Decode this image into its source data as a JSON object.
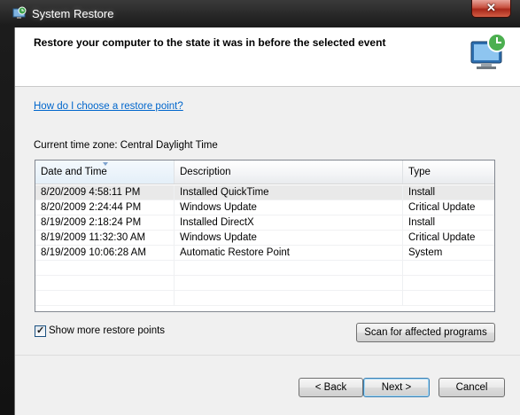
{
  "window": {
    "title": "System Restore",
    "close_glyph": "✕",
    "app_icon": "system-restore-icon"
  },
  "header": {
    "instruction": "Restore your computer to the state it was in before the selected event",
    "icon": "system-restore-monitor-icon"
  },
  "help_link": "How do I choose a restore point?",
  "timezone": "Current time zone: Central Daylight Time",
  "table": {
    "columns": [
      "Date and Time",
      "Description",
      "Type"
    ],
    "sorted_column": "Date and Time",
    "rows": [
      [
        "8/20/2009 4:58:11 PM",
        "Installed QuickTime",
        "Install"
      ],
      [
        "8/20/2009 2:24:44 PM",
        "Windows Update",
        "Critical Update"
      ],
      [
        "8/19/2009 2:18:24 PM",
        "Installed DirectX",
        "Install"
      ],
      [
        "8/19/2009 11:32:30 AM",
        "Windows Update",
        "Critical Update"
      ],
      [
        "8/19/2009 10:06:28 AM",
        "Automatic Restore Point",
        "System"
      ]
    ],
    "selected_row": 0
  },
  "show_more": {
    "label": "Show more restore points",
    "checked": true,
    "check_glyph": "✓"
  },
  "scan_button": "Scan for affected programs",
  "nav": {
    "back": "< Back",
    "next": "Next >",
    "cancel": "Cancel"
  },
  "colors": {
    "link": "#0066cc",
    "close_button": "#c7503f",
    "selected_row": "#e9e9e9"
  }
}
